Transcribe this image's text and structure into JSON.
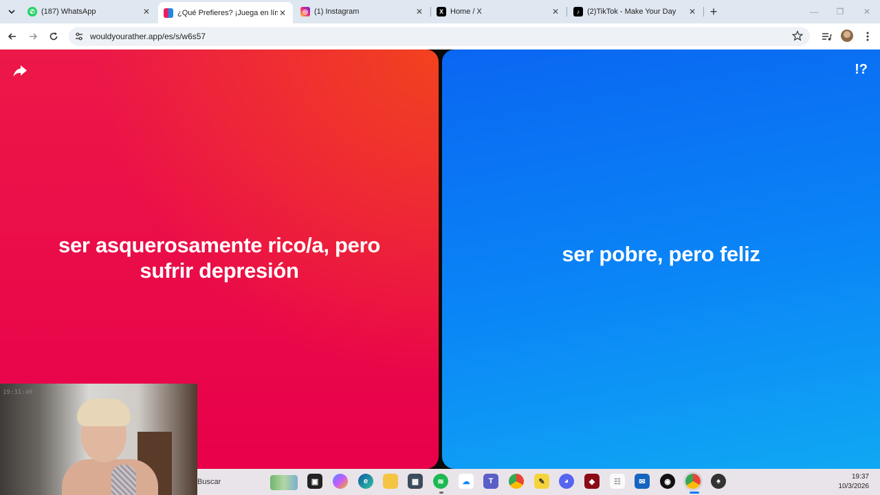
{
  "browser": {
    "tabs": [
      {
        "title": "(187) WhatsApp",
        "icon": "whatsapp-icon",
        "color": "#25d366"
      },
      {
        "title": "¿Qué Prefieres? ¡Juega en línea!",
        "icon": "wyr-icon",
        "color": "#e91e63",
        "active": true
      },
      {
        "title": "(1) Instagram",
        "icon": "instagram-icon",
        "color": "#d62976"
      },
      {
        "title": "Home / X",
        "icon": "x-icon",
        "color": "#000000"
      },
      {
        "title": "(2)TikTok - Make Your Day",
        "icon": "tiktok-icon",
        "color": "#000000"
      }
    ],
    "url": "wouldyourather.app/es/s/w6s57"
  },
  "game": {
    "option_left": "ser asquerosamente rico/a, pero sufrir depresión",
    "option_right": "ser pobre, pero feliz",
    "right_badge": "!?",
    "colors": {
      "left": "#e8004a",
      "right": "#0a86f6"
    }
  },
  "webcam": {
    "timestamp": "19:31:40"
  },
  "taskbar": {
    "search_placeholder": "Buscar",
    "time": "19:37",
    "date": "10/3/2026",
    "apps": [
      "file-explorer-icon",
      "copilot-icon",
      "edge-icon",
      "folder-icon",
      "calculator-icon",
      "spotify-icon",
      "onedrive-icon",
      "teams-icon",
      "chrome-icon",
      "notes-icon",
      "discord-icon",
      "app-icon",
      "sketch-icon",
      "outlook-icon",
      "obs-icon",
      "chrome-active-icon",
      "app2-icon"
    ]
  }
}
